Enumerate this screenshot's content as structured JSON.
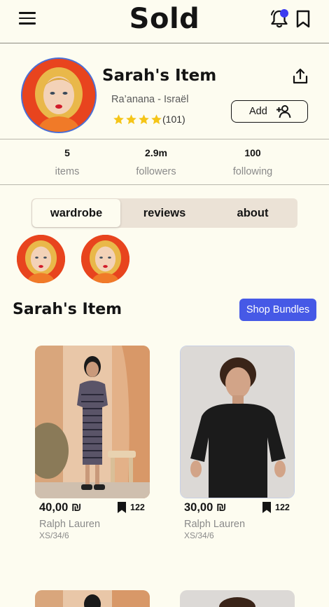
{
  "header": {
    "app_title": "Sold"
  },
  "profile": {
    "name": "Sarah's Item",
    "location": "Ra’anana - Israël",
    "rating_stars": 4,
    "rating_count": "(101)",
    "add_label": "Add"
  },
  "stats": [
    {
      "value": "5",
      "label": "items"
    },
    {
      "value": "2.9m",
      "label": "followers"
    },
    {
      "value": "100",
      "label": "following"
    }
  ],
  "tabs": [
    {
      "label": "wardrobe",
      "active": true
    },
    {
      "label": "reviews",
      "active": false
    },
    {
      "label": "about",
      "active": false
    }
  ],
  "section": {
    "title": "Sarah's Item",
    "bundles_label": "Shop Bundles"
  },
  "products": [
    {
      "price": "40,00 ₪",
      "saves": "122",
      "brand": "Ralph Lauren",
      "size": "XS/34/6"
    },
    {
      "price": "30,00 ₪",
      "saves": "122",
      "brand": "Ralph Lauren",
      "size": "XS/34/6"
    }
  ],
  "colors": {
    "accent": "#4659e6",
    "notification_dot": "#3c3cf0",
    "star": "#f5c518",
    "background": "#fdfcf0"
  },
  "icons": [
    "menu-icon",
    "bell-icon",
    "bookmark-icon",
    "share-icon",
    "add-user-icon",
    "star-icon"
  ]
}
